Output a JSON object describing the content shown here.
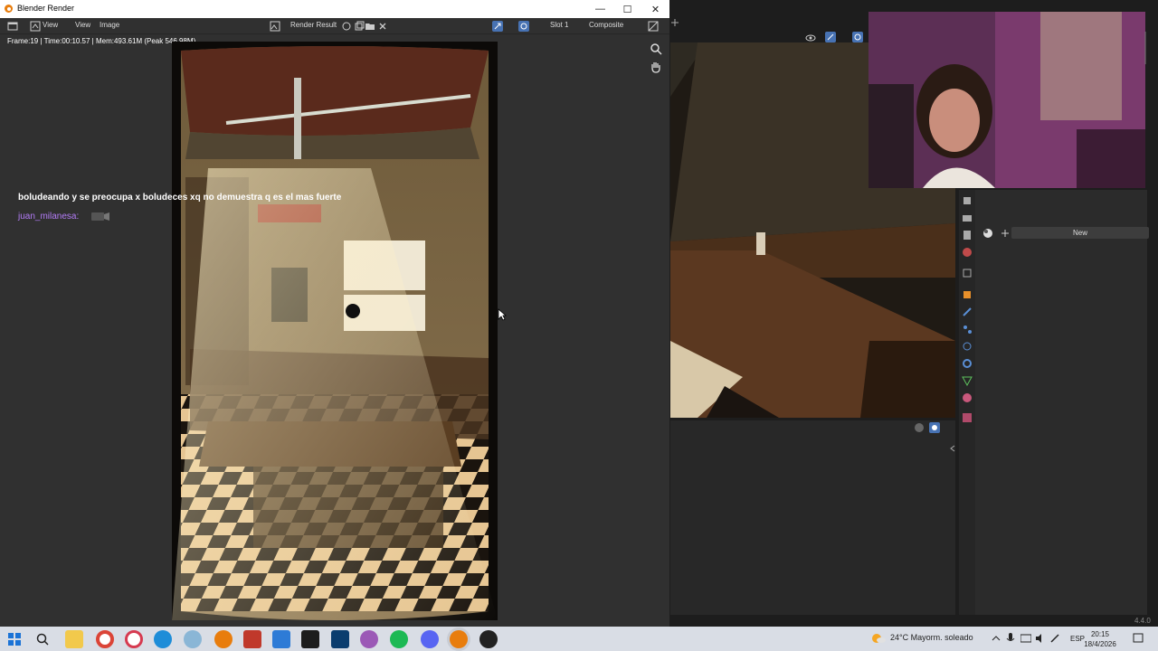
{
  "window": {
    "title": "Blender Render"
  },
  "render_header": {
    "view_menu": "View",
    "view_label": "View",
    "image_menu": "Image",
    "render_result": "Render Result",
    "slot": "Slot 1",
    "composite": "Composite"
  },
  "stats": "Frame:19 | Time:00:10.57 | Mem:493.61M (Peak 546.98M)",
  "chat": {
    "message": "boludeando y se preocupa x boludeces xq no demuestra q es el mas fuerte",
    "username": "juan_milanesa:"
  },
  "properties": {
    "new_button": "New"
  },
  "version": "4.4.0",
  "taskbar": {
    "weather": "24°C  Mayorm. soleado",
    "language": "ESP",
    "time": "20:15",
    "date": "18/4/2026"
  },
  "colors": {
    "accent": "#4772b3",
    "chat_username": "#b37cf7"
  }
}
